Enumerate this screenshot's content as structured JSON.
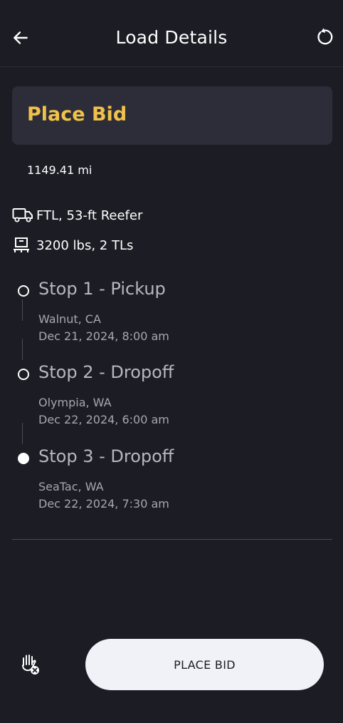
{
  "header": {
    "title": "Load Details",
    "back_icon": "arrow-left-icon",
    "refresh_icon": "refresh-icon"
  },
  "bid_card": {
    "title": "Place Bid"
  },
  "distance": "1149.41 mi",
  "equipment": {
    "icon": "truck-icon",
    "text": "FTL, 53-ft Reefer"
  },
  "weight": {
    "icon": "pallet-icon",
    "text": "3200 lbs, 2 TLs"
  },
  "stops": [
    {
      "title": "Stop 1 - Pickup",
      "city": "Walnut, CA",
      "time": "Dec 21, 2024, 8:00 am",
      "completed": false
    },
    {
      "title": "Stop 2 - Dropoff",
      "city": "Olympia, WA",
      "time": "Dec 22, 2024, 6:00 am",
      "completed": false
    },
    {
      "title": "Stop 3 - Dropoff",
      "city": "SeaTac, WA",
      "time": "Dec 22, 2024, 7:30 am",
      "completed": true
    }
  ],
  "footer": {
    "hand_icon": "hand-stop-icon",
    "button_label": "PLACE BID"
  },
  "colors": {
    "background": "#1c1c24",
    "card": "#2c2d39",
    "accent": "#f0c24b",
    "button": "#f1f1f8"
  }
}
